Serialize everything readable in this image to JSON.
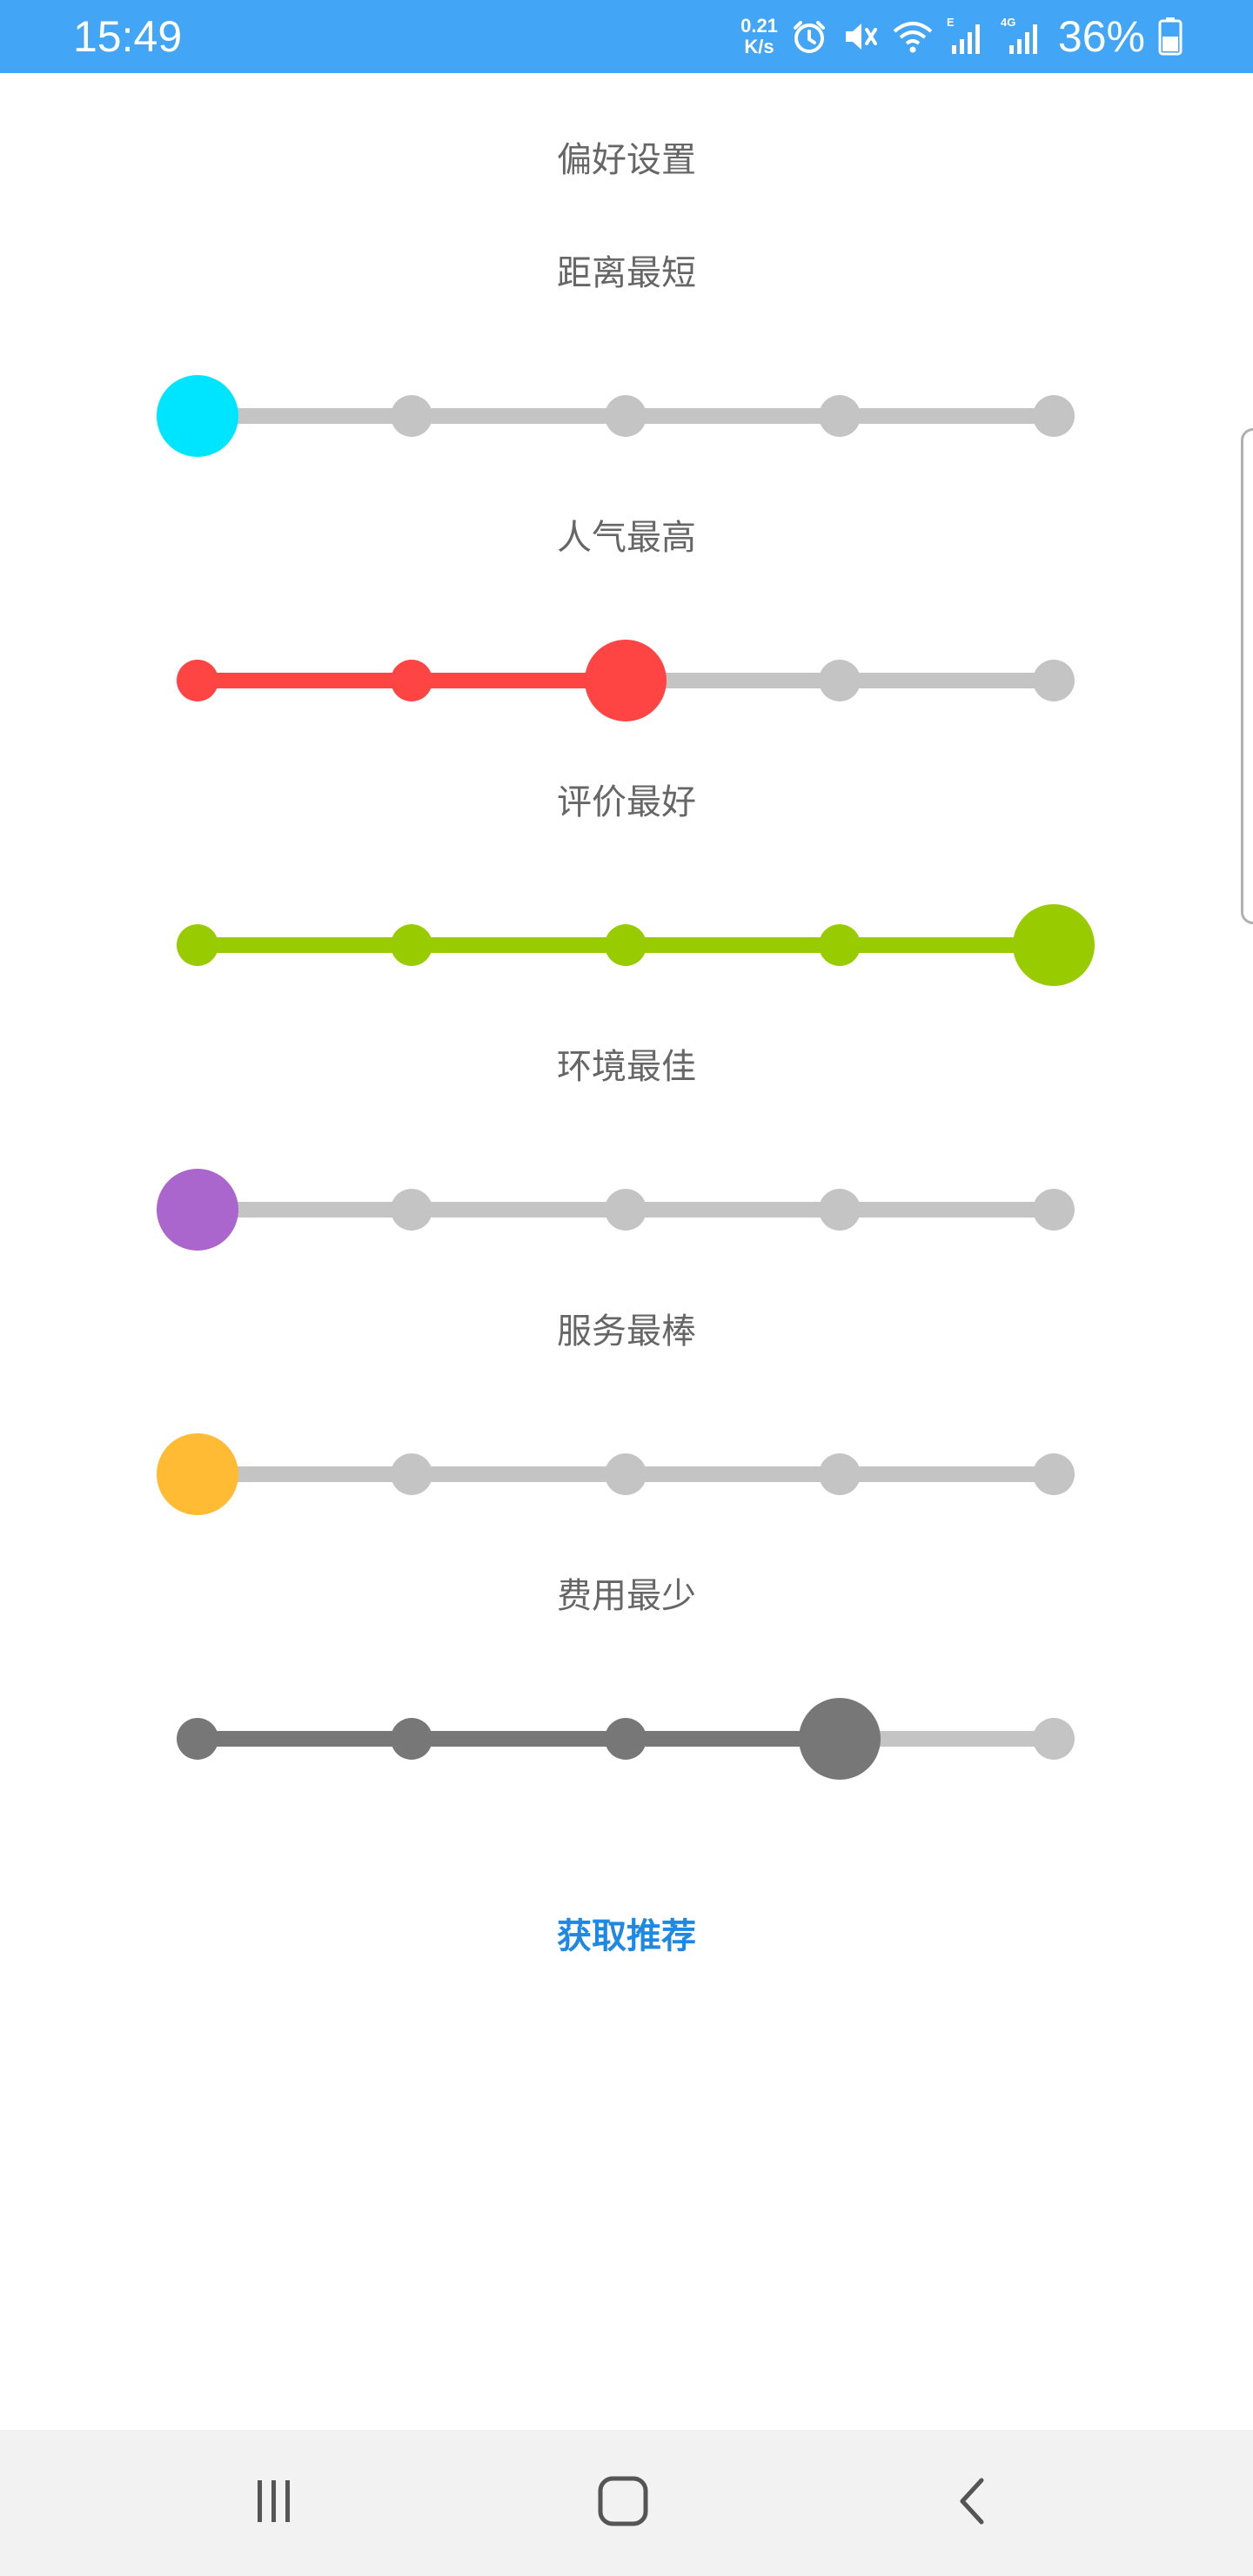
{
  "status_bar": {
    "time": "15:49",
    "net_speed_value": "0.21",
    "net_speed_unit": "K/s",
    "network_label_e": "E",
    "network_label_4g": "4G",
    "battery_percent": "36%",
    "background_color": "#42a5f5",
    "icons": [
      "alarm-icon",
      "mute-icon",
      "wifi-icon",
      "signal-icon",
      "signal-icon",
      "battery-icon"
    ]
  },
  "page": {
    "title": "偏好设置",
    "action_label": "获取推荐",
    "action_color": "#1e88e5"
  },
  "preferences": [
    {
      "label": "距离最短",
      "level": 0,
      "steps": 5,
      "color": "#00e5ff"
    },
    {
      "label": "人气最高",
      "level": 2,
      "steps": 5,
      "color": "#ff4444"
    },
    {
      "label": "评价最好",
      "level": 4,
      "steps": 5,
      "color": "#99cc00"
    },
    {
      "label": "环境最佳",
      "level": 0,
      "steps": 5,
      "color": "#aa66cc"
    },
    {
      "label": "服务最棒",
      "level": 0,
      "steps": 5,
      "color": "#ffbb33"
    },
    {
      "label": "费用最少",
      "level": 3,
      "steps": 5,
      "color": "#777777"
    }
  ],
  "inactive_color": "#c4c4c4",
  "nav_bar": {
    "icons": [
      "recent-apps-icon",
      "home-icon",
      "back-icon"
    ]
  }
}
